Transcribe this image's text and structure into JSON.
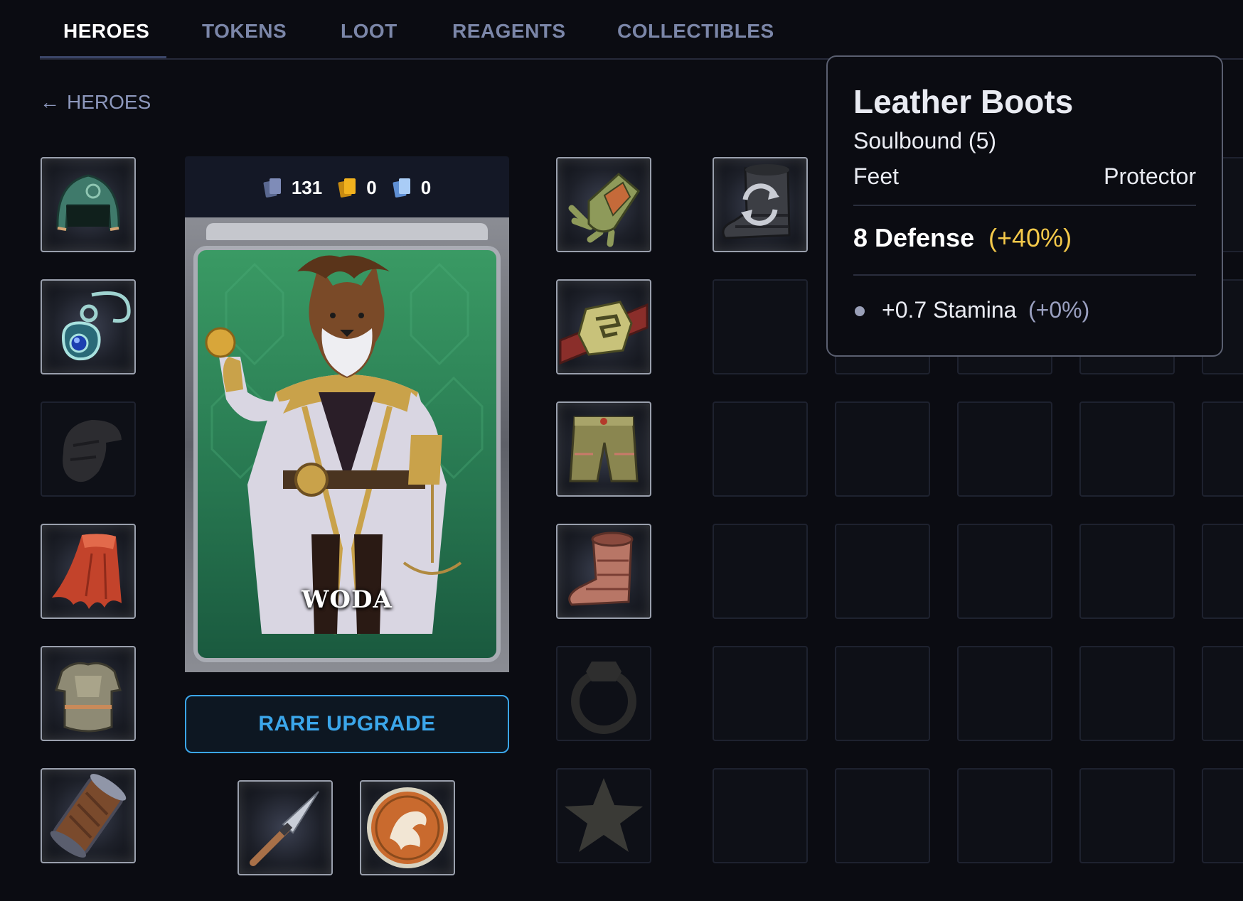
{
  "tabs": [
    {
      "label": "HEROES",
      "active": true
    },
    {
      "label": "TOKENS",
      "active": false
    },
    {
      "label": "LOOT",
      "active": false
    },
    {
      "label": "REAGENTS",
      "active": false
    },
    {
      "label": "COLLECTIBLES",
      "active": false
    }
  ],
  "back_link": {
    "label": "HEROES",
    "icon": "arrow-left-icon"
  },
  "card": {
    "name": "WODA",
    "counts": [
      {
        "icon": "card-stack-gray-icon",
        "value": "131",
        "color": "#6b7ab0"
      },
      {
        "icon": "card-stack-gold-icon",
        "value": "0",
        "color": "#f2b21e"
      },
      {
        "icon": "card-stack-blue-icon",
        "value": "0",
        "color": "#8ab8f0"
      }
    ]
  },
  "upgrade_button": {
    "label": "RARE UPGRADE"
  },
  "tooltip": {
    "title": "Leather Boots",
    "binding": "Soulbound (5)",
    "slot": "Feet",
    "class": "Protector",
    "defense": "8 Defense",
    "defense_bonus": "(+40%)",
    "stat": "+0.7 Stamina",
    "stat_bonus": "(+0%)"
  },
  "equipment_left": [
    "helmet-icon",
    "amulet-icon",
    "shoulders-placeholder-icon",
    "cape-icon",
    "chest-armor-icon",
    "bracers-icon"
  ],
  "equipment_right": [
    "gloves-icon",
    "belt-icon",
    "pants-icon",
    "boots-icon",
    "ring-placeholder-icon",
    "trinket-placeholder-icon"
  ],
  "weapons": [
    "spear-icon",
    "shield-icon"
  ],
  "colors": {
    "accent": "#3ba6ea",
    "bonus": "#f4c94a",
    "background": "#0b0c12"
  }
}
